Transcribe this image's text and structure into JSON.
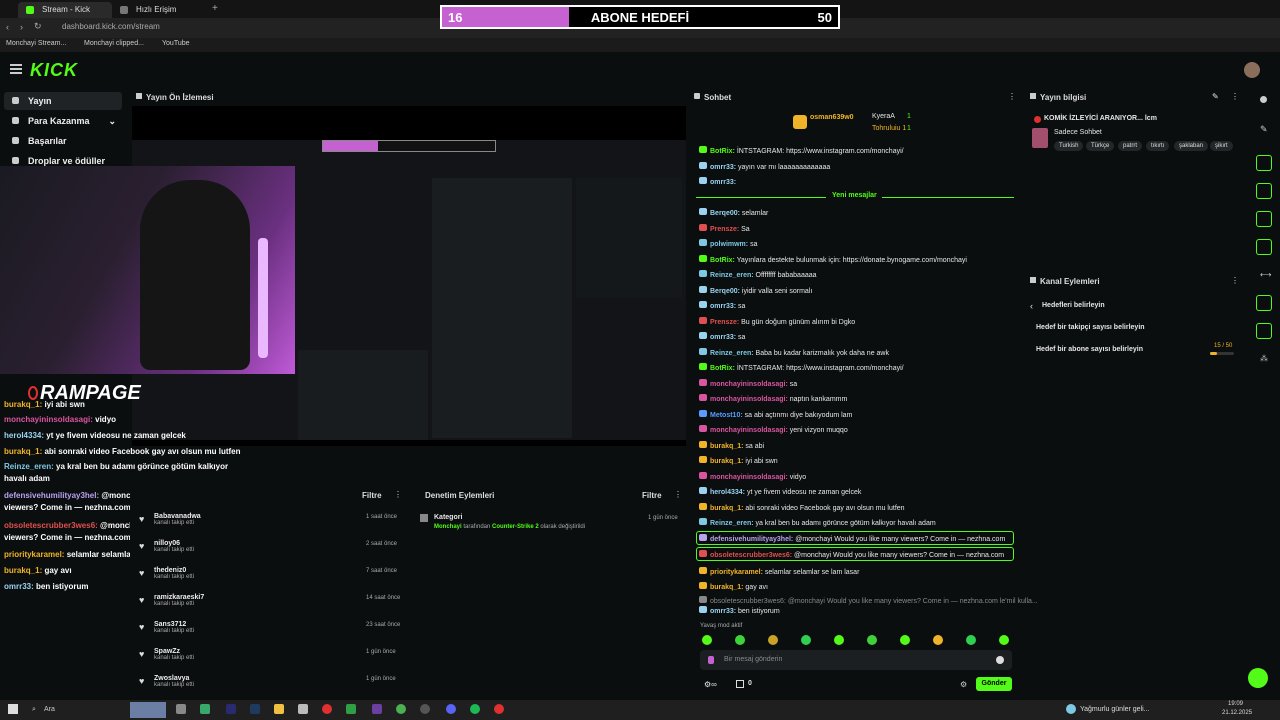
{
  "browser": {
    "tabs": [
      {
        "label": "Stream - Kick Dashbo"
      },
      {
        "label": "Hızlı Erişim"
      }
    ],
    "url": "dashboard.kick.com/stream",
    "bookmarks": [
      "Monchayi Stream...",
      "Monchayi clipped...",
      "YouTube"
    ]
  },
  "goal": {
    "current": "16",
    "title": "ABONE HEDEFİ",
    "target": "50",
    "progress_fraction": 0.32
  },
  "brand": {
    "logo": "KICK",
    "accent": "#53fc18"
  },
  "nav": {
    "items": [
      {
        "label": "Yayın"
      },
      {
        "label": "Para Kazanma"
      },
      {
        "label": "Başarılar"
      },
      {
        "label": "Droplar ve ödüller"
      }
    ]
  },
  "preview": {
    "title": "Yayın Ön İzlemesi",
    "overlay_logo": "RAMPAGE",
    "overlay_chat": [
      {
        "user": "burakq_1:",
        "text": " iyi abi swn",
        "color": "#f0b429"
      },
      {
        "user": "monchayininsoldasagi:",
        "text": " vidyo",
        "color": "#d9559f"
      },
      {
        "user": "herol4334:",
        "text": " yt ye fivem videosu ne zaman gelcek",
        "color": "#9ad3f0"
      },
      {
        "user": "burakq_1:",
        "text": " abi sonraki video Facebook gay avı olsun mu lutfen",
        "color": "#f0b429"
      },
      {
        "user": "Reinze_eren:",
        "text": " ya kral ben bu adamı görünce götüm kalkıyor",
        "color": "#7ec8e3"
      },
      {
        "user": "",
        "text": "havalı adam",
        "color": "#fff"
      },
      {
        "user": "defensivehumilityay3hel:",
        "text": " @monchayi Would you like many",
        "color": "#b9a3f0"
      },
      {
        "user": "",
        "text": "viewers? Come in — nezhna.com",
        "color": "#fff"
      },
      {
        "user": "obsoletescrubber3wes6:",
        "text": " @monchayi Would you like many",
        "color": "#e05050"
      },
      {
        "user": "",
        "text": "viewers? Come in — nezhna.com",
        "color": "#fff"
      },
      {
        "user": "prioritykaramel:",
        "text": " selamlar selamlar se lam lasar",
        "color": "#f0b429"
      },
      {
        "user": "burakq_1:",
        "text": " gay avı",
        "color": "#f0b429"
      },
      {
        "user": "omrr33:",
        "text": " ben istiyorum",
        "color": "#9ad3f0"
      }
    ]
  },
  "follows": {
    "header_action": "Filtre",
    "rows": [
      {
        "name": "Babavanadwa",
        "sub": "kanalı takip etti",
        "time": "1 saat önce"
      },
      {
        "name": "nilloy06",
        "sub": "kanalı takip etti",
        "time": "2 saat önce"
      },
      {
        "name": "thedeniz0",
        "sub": "kanalı takip etti",
        "time": "7 saat önce"
      },
      {
        "name": "ramizkaraeski7",
        "sub": "kanalı takip etti",
        "time": "14 saat önce"
      },
      {
        "name": "Sans3712",
        "sub": "kanalı takip etti",
        "time": "23 saat önce"
      },
      {
        "name": "SpawZz",
        "sub": "kanalı takip etti",
        "time": "1 gün önce"
      },
      {
        "name": "Zwoslavya",
        "sub": "kanalı takip etti",
        "time": "1 gün önce"
      }
    ]
  },
  "audit": {
    "title": "Denetim Eylemleri",
    "filter": "Filtre",
    "entry_title": "Kategori",
    "entry_user": "Monchayi",
    "entry_mid": " tarafından ",
    "entry_game": "Counter-Strike 2",
    "entry_end": " olarak değiştirildi",
    "entry_time": "1 gün önce"
  },
  "chat": {
    "title": "Sohbet",
    "pinned": [
      {
        "name": "osman639w0",
        "count": ""
      },
      {
        "name": "KyeraA",
        "count": "1"
      },
      {
        "name": "Tohruluiu 1",
        "count": "1"
      }
    ],
    "new_messages_label": "Yeni mesajlar",
    "messages": [
      {
        "user": "BotRix:",
        "text": " İNTSTAGRAM: https://www.instagram.com/monchayi/",
        "color": "#53fc18"
      },
      {
        "user": "omrr33:",
        "text": " yayın var mı laaaaaaaaaaaaa",
        "color": "#9ad3f0"
      },
      {
        "user": "omrr33:",
        "text": "",
        "color": "#9ad3f0"
      },
      {
        "user": "Berqe00:",
        "text": " selamlar",
        "color": "#9ad3f0"
      },
      {
        "user": "Prensze:",
        "text": " Sa",
        "color": "#e05050"
      },
      {
        "user": "polwimwm:",
        "text": " sa",
        "color": "#7ec8e3"
      },
      {
        "user": "BotRix:",
        "text": " Yayınlara destekte bulunmak için: https://donate.bynogame.com/monchayi",
        "color": "#53fc18"
      },
      {
        "user": "Reinze_eren:",
        "text": " Offffffff bababaaaaa",
        "color": "#7ec8e3"
      },
      {
        "user": "Berqe00:",
        "text": " iyidir valla seni sormalı",
        "color": "#9ad3f0"
      },
      {
        "user": "omrr33:",
        "text": " sa",
        "color": "#9ad3f0"
      },
      {
        "user": "Prensze:",
        "text": " Bu gün doğum günüm alırım bi Dgko",
        "color": "#e05050"
      },
      {
        "user": "omrr33:",
        "text": " sa",
        "color": "#9ad3f0"
      },
      {
        "user": "Reinze_eren:",
        "text": " Baba bu kadar karizmalık yok daha ne awk",
        "color": "#7ec8e3"
      },
      {
        "user": "BotRix:",
        "text": " İNTSTAGRAM: https://www.instagram.com/monchayi/",
        "color": "#53fc18"
      },
      {
        "user": "monchayininsoldasagi:",
        "text": " sa",
        "color": "#d9559f"
      },
      {
        "user": "monchayininsoldasagi:",
        "text": " naptın kankammm",
        "color": "#d9559f"
      },
      {
        "user": "Metost10:",
        "text": " sa abi açtınmı diye bakıyodum lam",
        "color": "#5b9bff"
      },
      {
        "user": "monchayininsoldasagi:",
        "text": " yeni vizyon muqqo",
        "color": "#d9559f"
      },
      {
        "user": "burakq_1:",
        "text": " sa abi",
        "color": "#f0b429"
      },
      {
        "user": "burakq_1:",
        "text": " iyi abi swn",
        "color": "#f0b429"
      },
      {
        "user": "monchayininsoldasagi:",
        "text": " vidyo",
        "color": "#d9559f"
      },
      {
        "user": "herol4334:",
        "text": " yt ye fivem videosu ne zaman gelcek",
        "color": "#9ad3f0"
      },
      {
        "user": "burakq_1:",
        "text": " abi sonraki video Facebook gay avı olsun mu lutfen",
        "color": "#f0b429"
      },
      {
        "user": "Reinze_eren:",
        "text": " ya kral ben bu adamı görünce götüm kalkıyor havalı adam",
        "color": "#7ec8e3"
      },
      {
        "user": "defensivehumilityay3hel:",
        "text": " @monchayi Would you like many viewers? Come in — nezhna.com",
        "color": "#b9a3f0"
      },
      {
        "user": "obsoletescrubber3wes6:",
        "text": " @monchayi Would you like many viewers? Come in — nezhna.com",
        "color": "#e05050"
      },
      {
        "user": "prioritykaramel:",
        "text": " selamlar selamlar se lam lasar",
        "color": "#f0b429"
      },
      {
        "user": "burakq_1:",
        "text": " gay avı",
        "color": "#f0b429"
      },
      {
        "user": "",
        "text": "obsoletescrubber3wes6: @monchayi Would you like many viewers? Come in — nezhna.com le'mil kulla...",
        "color": "#888"
      },
      {
        "user": "omrr33:",
        "text": " ben istiyorum",
        "color": "#9ad3f0"
      }
    ],
    "slow_mode": "Yavaş mod aktif",
    "input_placeholder": "Bir mesaj gönderin",
    "footer_count": "0",
    "send_label": "Gönder"
  },
  "stream_info": {
    "title": "Yayın bilgisi",
    "stream_title": "KOMİK İZLEYİCİ ARANIYOR... lcm",
    "category": "Sadece Sohbet",
    "tags": [
      "Turkish",
      "Türkçe",
      "patrrt",
      "tıkırtı",
      "şaklaban",
      "şikırt"
    ]
  },
  "channel_actions": {
    "title": "Kanal Eylemleri",
    "back_label": "Hedefleri belirleyin",
    "items": [
      {
        "label": "Hedef bir takipçi sayısı belirleyin",
        "progress": ""
      },
      {
        "label": "Hedef bir abone sayısı belirleyin",
        "progress": "15 / 50",
        "fraction": 0.3
      }
    ]
  },
  "taskbar": {
    "search": "Ara",
    "weather": "Yağmurlu günler geli...",
    "time": "19:09",
    "date": "21.12.2025"
  }
}
